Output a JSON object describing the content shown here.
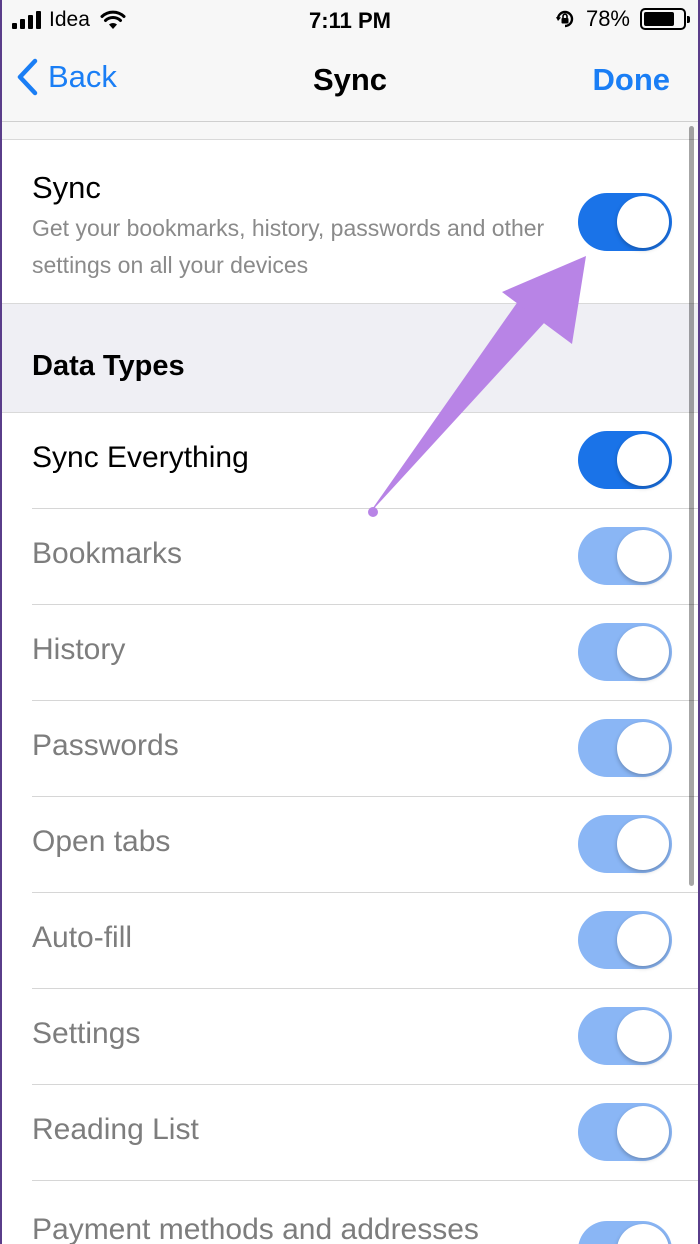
{
  "status_bar": {
    "carrier": "Idea",
    "time": "7:11 PM",
    "battery_percent": "78%",
    "battery_level": 0.78
  },
  "nav": {
    "back_label": "Back",
    "title": "Sync",
    "done_label": "Done"
  },
  "sync": {
    "title": "Sync",
    "description": "Get your bookmarks, history, passwords and other settings on all your devices",
    "enabled": true
  },
  "section": {
    "title": "Data Types"
  },
  "data_types": [
    {
      "label": "Sync Everything",
      "on": true,
      "primary": true
    },
    {
      "label": "Bookmarks",
      "on": true,
      "primary": false
    },
    {
      "label": "History",
      "on": true,
      "primary": false
    },
    {
      "label": "Passwords",
      "on": true,
      "primary": false
    },
    {
      "label": "Open tabs",
      "on": true,
      "primary": false
    },
    {
      "label": "Auto-fill",
      "on": true,
      "primary": false
    },
    {
      "label": "Settings",
      "on": true,
      "primary": false
    },
    {
      "label": "Reading List",
      "on": true,
      "primary": false
    },
    {
      "label": "Payment methods and addresses",
      "on": true,
      "primary": false
    }
  ],
  "colors": {
    "accent": "#1a7ef5",
    "toggle_on": "#1a73e8",
    "toggle_on_disabled": "#8ab6f5",
    "annotation_arrow": "#b884e6"
  },
  "icons": {
    "back": "chevron-left-icon",
    "wifi": "wifi-icon",
    "rotation_lock": "rotation-lock-icon",
    "battery": "battery-icon",
    "signal": "cellular-signal-icon"
  }
}
